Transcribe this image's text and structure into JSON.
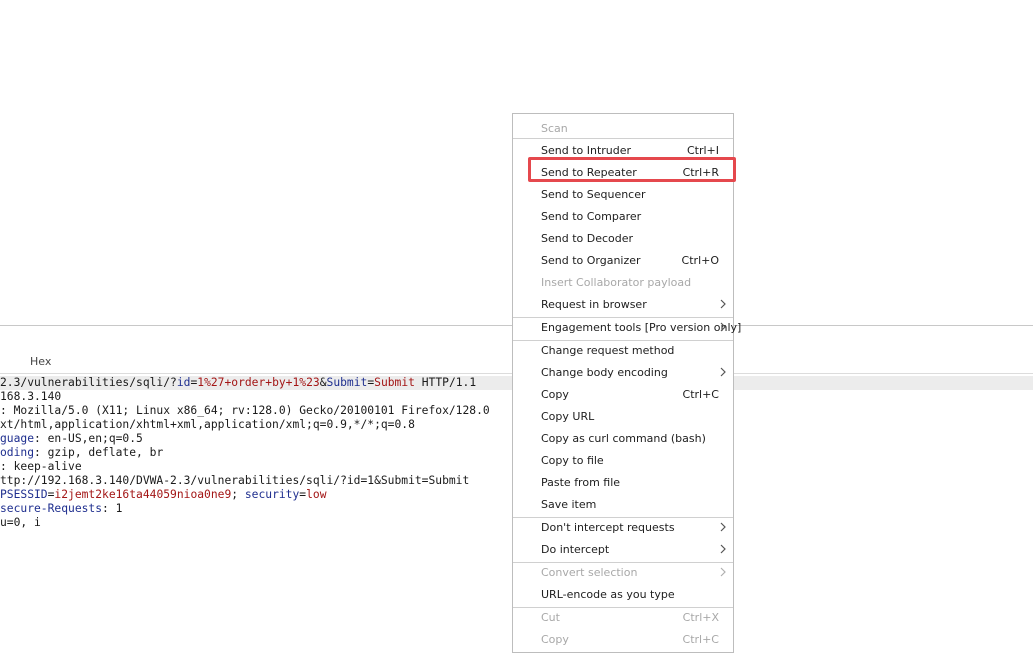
{
  "editor": {
    "tab_hex": "Hex",
    "lines": [
      [
        {
          "t": "2.3/vulnerabilities/sqli/?",
          "c": ""
        },
        {
          "t": "id",
          "c": "hk"
        },
        {
          "t": "=",
          "c": ""
        },
        {
          "t": "1%27+order+by+1%23",
          "c": "hv"
        },
        {
          "t": "&",
          "c": ""
        },
        {
          "t": "Submit",
          "c": "hk"
        },
        {
          "t": "=",
          "c": ""
        },
        {
          "t": "Submit",
          "c": "hv"
        },
        {
          "t": " HTTP/1.1",
          "c": ""
        }
      ],
      [
        {
          "t": "168.3.140",
          "c": ""
        }
      ],
      [
        {
          "t": ": Mozilla/5.0 (X11; Linux x86_64; rv:128.0) Gecko/20100101 Firefox/128.0",
          "c": ""
        }
      ],
      [
        {
          "t": "xt/html,application/xhtml+xml,application/xml;q=0.9,*/*;q=0.8",
          "c": ""
        }
      ],
      [
        {
          "t": "guage",
          "c": "hk"
        },
        {
          "t": ": en-US,en;q=0.5",
          "c": ""
        }
      ],
      [
        {
          "t": "oding",
          "c": "hk"
        },
        {
          "t": ": gzip, deflate, br",
          "c": ""
        }
      ],
      [
        {
          "t": ": keep-alive",
          "c": ""
        }
      ],
      [
        {
          "t": "ttp://192.168.3.140/DVWA-2.3/vulnerabilities/sqli/?id=1&Submit=Submit",
          "c": ""
        }
      ],
      [
        {
          "t": "PSESSID",
          "c": "hk"
        },
        {
          "t": "=",
          "c": ""
        },
        {
          "t": "i2jemt2ke16ta44059nioa0ne9",
          "c": "hv"
        },
        {
          "t": "; ",
          "c": ""
        },
        {
          "t": "security",
          "c": "hk"
        },
        {
          "t": "=",
          "c": ""
        },
        {
          "t": "low",
          "c": "hv"
        }
      ],
      [
        {
          "t": "secure-Requests",
          "c": "hk"
        },
        {
          "t": ": 1",
          "c": ""
        }
      ],
      [
        {
          "t": "u=0, i",
          "c": ""
        }
      ]
    ]
  },
  "context_menu": {
    "items": [
      {
        "label": "Scan",
        "shortcut": "",
        "submenu": false,
        "disabled": true,
        "name": "menu-item-scan"
      },
      {
        "label": "Send to Intruder",
        "shortcut": "Ctrl+I",
        "submenu": false,
        "disabled": false,
        "name": "menu-item-send-to-intruder"
      },
      {
        "label": "Send to Repeater",
        "shortcut": "Ctrl+R",
        "submenu": false,
        "disabled": false,
        "name": "menu-item-send-to-repeater"
      },
      {
        "label": "Send to Sequencer",
        "shortcut": "",
        "submenu": false,
        "disabled": false,
        "name": "menu-item-send-to-sequencer"
      },
      {
        "label": "Send to Comparer",
        "shortcut": "",
        "submenu": false,
        "disabled": false,
        "name": "menu-item-send-to-comparer"
      },
      {
        "label": "Send to Decoder",
        "shortcut": "",
        "submenu": false,
        "disabled": false,
        "name": "menu-item-send-to-decoder"
      },
      {
        "label": "Send to Organizer",
        "shortcut": "Ctrl+O",
        "submenu": false,
        "disabled": false,
        "name": "menu-item-send-to-organizer"
      },
      {
        "label": "Insert Collaborator payload",
        "shortcut": "",
        "submenu": false,
        "disabled": true,
        "name": "menu-item-insert-collaborator-payload"
      },
      {
        "label": "Request in browser",
        "shortcut": "",
        "submenu": true,
        "disabled": false,
        "name": "menu-item-request-in-browser"
      },
      {
        "label": "Engagement tools [Pro version only]",
        "shortcut": "",
        "submenu": true,
        "disabled": false,
        "name": "menu-item-engagement-tools"
      },
      {
        "label": "Change request method",
        "shortcut": "",
        "submenu": false,
        "disabled": false,
        "name": "menu-item-change-request-method"
      },
      {
        "label": "Change body encoding",
        "shortcut": "",
        "submenu": true,
        "disabled": false,
        "name": "menu-item-change-body-encoding"
      },
      {
        "label": "Copy",
        "shortcut": "Ctrl+C",
        "submenu": false,
        "disabled": false,
        "name": "menu-item-copy"
      },
      {
        "label": "Copy URL",
        "shortcut": "",
        "submenu": false,
        "disabled": false,
        "name": "menu-item-copy-url"
      },
      {
        "label": "Copy as curl command (bash)",
        "shortcut": "",
        "submenu": false,
        "disabled": false,
        "name": "menu-item-copy-as-curl"
      },
      {
        "label": "Copy to file",
        "shortcut": "",
        "submenu": false,
        "disabled": false,
        "name": "menu-item-copy-to-file"
      },
      {
        "label": "Paste from file",
        "shortcut": "",
        "submenu": false,
        "disabled": false,
        "name": "menu-item-paste-from-file"
      },
      {
        "label": "Save item",
        "shortcut": "",
        "submenu": false,
        "disabled": false,
        "name": "menu-item-save-item"
      },
      {
        "label": "Don't intercept requests",
        "shortcut": "",
        "submenu": true,
        "disabled": false,
        "name": "menu-item-dont-intercept-requests"
      },
      {
        "label": "Do intercept",
        "shortcut": "",
        "submenu": true,
        "disabled": false,
        "name": "menu-item-do-intercept"
      },
      {
        "label": "Convert selection",
        "shortcut": "",
        "submenu": true,
        "disabled": true,
        "name": "menu-item-convert-selection"
      },
      {
        "label": "URL-encode as you type",
        "shortcut": "",
        "submenu": false,
        "disabled": false,
        "name": "menu-item-url-encode-as-you-type"
      },
      {
        "label": "Cut",
        "shortcut": "Ctrl+X",
        "submenu": false,
        "disabled": true,
        "name": "menu-item-cut"
      },
      {
        "label": "Copy",
        "shortcut": "Ctrl+C",
        "submenu": false,
        "disabled": true,
        "name": "menu-item-copy-disabled"
      }
    ]
  },
  "colors": {
    "highlight": "#e5484d",
    "header_key": "#1f2f8f",
    "header_value": "#a31515",
    "disabled_text": "#a8a8a8"
  }
}
